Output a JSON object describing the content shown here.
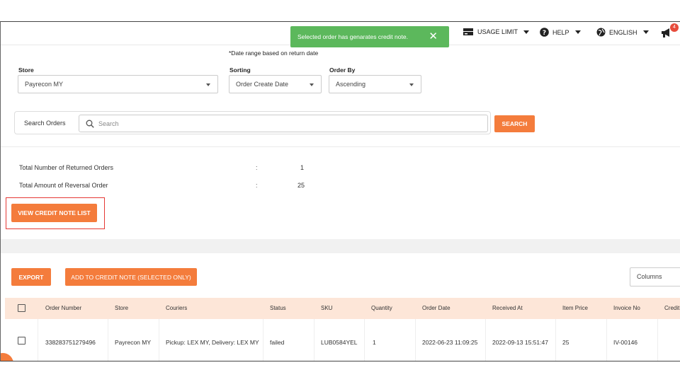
{
  "toast": {
    "message": "Selected order has genarates credit note.",
    "close": "✕"
  },
  "topbar": {
    "usage_limit": "USAGE LIMIT",
    "help": "HELP",
    "language": "ENGLISH",
    "notification_count": "4"
  },
  "filters": {
    "date_note": "*Date range based on return date",
    "store_label": "Store",
    "store_value": "Payrecon MY",
    "sorting_label": "Sorting",
    "sorting_value": "Order Create Date",
    "orderby_label": "Order By",
    "orderby_value": "Ascending"
  },
  "search": {
    "label": "Search Orders",
    "placeholder": "Search",
    "button": "SEARCH"
  },
  "stats": {
    "returned_label": "Total Number of Returned Orders",
    "returned_colon": ":",
    "returned_value": "1",
    "reversal_label": "Total Amount of Reversal Order",
    "reversal_colon": ":",
    "reversal_value": "25"
  },
  "view_credit_button": "VIEW CREDIT NOTE LIST",
  "actions": {
    "export": "EXPORT",
    "add_credit": "ADD TO CREDIT NOTE (SELECTED ONLY)",
    "columns": "Columns"
  },
  "table": {
    "headers": [
      "Order Number",
      "Store",
      "Couriers",
      "Status",
      "SKU",
      "Quantity",
      "Order Date",
      "Received At",
      "Item Price",
      "Invoice No",
      "Credit"
    ],
    "rows": [
      [
        "338283751279496",
        "Payrecon MY",
        "Pickup: LEX MY, Delivery: LEX MY",
        "failed",
        "LUB0584YEL",
        "1",
        "2022-06-23 11:09:25",
        "2022-09-13 15:51:47",
        "25",
        "IV-00146",
        ""
      ]
    ]
  },
  "colors": {
    "accent": "#f47c3c",
    "toast": "#5cb85c",
    "highlight": "#e53935",
    "header_bg": "#fde6d8"
  }
}
